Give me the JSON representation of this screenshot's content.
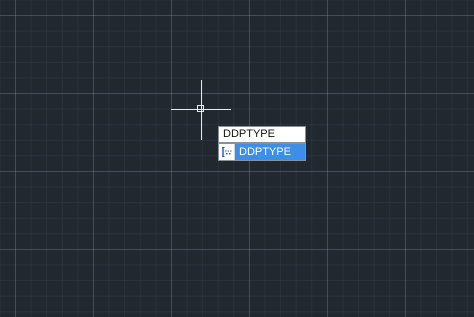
{
  "command_line": {
    "input_value": "DDPTYPE"
  },
  "autocomplete": {
    "items": [
      {
        "label": "DDPTYPE",
        "icon": "point-style-icon",
        "selected": true
      }
    ]
  },
  "colors": {
    "background": "#212830",
    "grid_major": "#5a6573",
    "grid_minor": "#333b45",
    "crosshair": "#e6ebef",
    "selection": "#3d8ee6"
  }
}
